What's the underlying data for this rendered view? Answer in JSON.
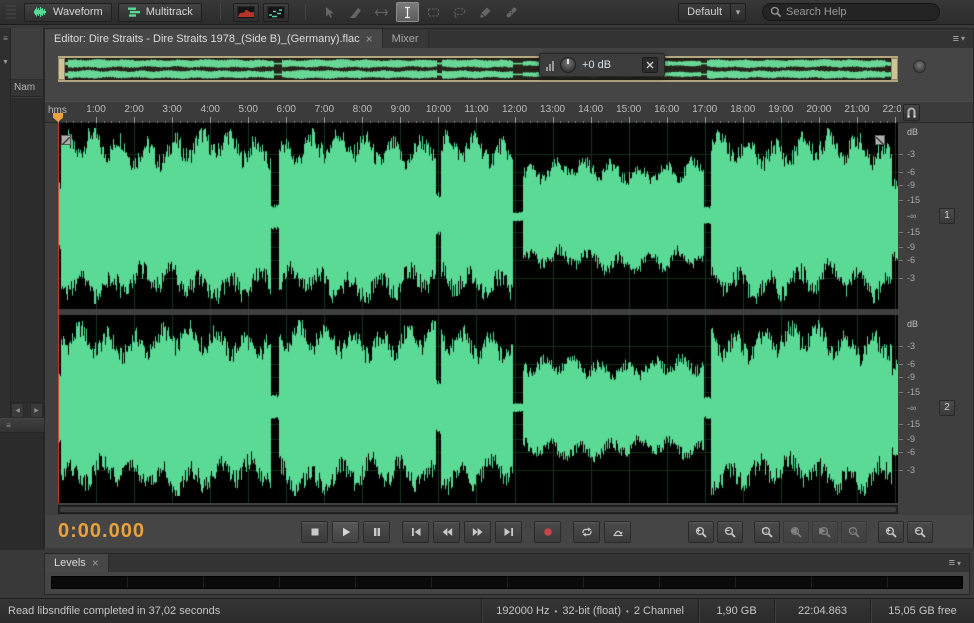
{
  "colors": {
    "wave_green": "#5ADA95",
    "grid_green": "#16361F",
    "center_green": "#2F7A48",
    "playhead_red": "#D83B3B",
    "handle_tan": "#CFC294",
    "accent_orange": "#E8A33D",
    "record_red": "#C84545"
  },
  "toolbar": {
    "waveform": "Waveform",
    "multitrack": "Multitrack",
    "workspace": "Default",
    "search_placeholder": "Search Help"
  },
  "tabs": {
    "editor": "Editor: Dire Straits - Dire Straits 1978_(Side B)_(Germany).flac",
    "mixer": "Mixer"
  },
  "hud": {
    "gain": "+0 dB"
  },
  "ruler": {
    "unit": "hms",
    "minute_ticks": [
      "1:00",
      "2:00",
      "3:00",
      "4:00",
      "5:00",
      "6:00",
      "7:00",
      "8:00",
      "9:00",
      "10:00",
      "11:00",
      "12:00",
      "13:00",
      "14:00",
      "15:00",
      "16:00",
      "17:00",
      "18:00",
      "19:00",
      "20:00",
      "21:00",
      "22:00"
    ]
  },
  "scale": {
    "header": "dB",
    "db_values": [
      -3,
      -6,
      -9,
      -15
    ],
    "db_labels": [
      "-3",
      "-6",
      "-9",
      "-15"
    ],
    "inf_label": "-∞"
  },
  "channels": {
    "one": "1",
    "two": "2"
  },
  "transport": {
    "time": "0:00.000"
  },
  "zoom": {
    "overlays": [
      "+",
      "−",
      "□",
      "◀",
      "▶",
      "□",
      "+",
      "−"
    ]
  },
  "levels": {
    "title": "Levels"
  },
  "files_panel": {
    "name_header": "Nam"
  },
  "status": {
    "message": "Read libsndfile completed in 37,02 seconds",
    "sample_rate": "192000 Hz",
    "bit_depth": "32-bit (float)",
    "channels": "2 Channel",
    "file_size": "1,90 GB",
    "duration": "22:04.863",
    "free_space": "15,05 GB free",
    "bullet": "•"
  },
  "icons": {
    "panel_menu": "≡",
    "chevron_down": "▾",
    "close": "×",
    "arrow_left": "◀",
    "arrow_right": "▶",
    "arrow_down": "▼"
  },
  "waveform": {
    "duration_min": 22.08,
    "segments": [
      {
        "t0": 0.0,
        "t1": 0.06,
        "a1": 0.4,
        "a2": 0.4
      },
      {
        "t0": 0.06,
        "t1": 5.58,
        "a1": 0.93,
        "a2": 0.92
      },
      {
        "t0": 5.58,
        "t1": 5.8,
        "a1": 0.16,
        "a2": 0.16
      },
      {
        "t0": 5.8,
        "t1": 9.93,
        "a1": 0.93,
        "a2": 0.93
      },
      {
        "t0": 9.93,
        "t1": 10.06,
        "a1": 0.3,
        "a2": 0.3
      },
      {
        "t0": 10.06,
        "t1": 11.95,
        "a1": 0.9,
        "a2": 0.9
      },
      {
        "t0": 11.95,
        "t1": 12.22,
        "a1": 0.06,
        "a2": 0.06
      },
      {
        "t0": 12.22,
        "t1": 16.98,
        "a1": 0.62,
        "a2": 0.56
      },
      {
        "t0": 16.98,
        "t1": 17.15,
        "a1": 0.13,
        "a2": 0.13
      },
      {
        "t0": 17.15,
        "t1": 21.9,
        "a1": 0.92,
        "a2": 0.92
      },
      {
        "t0": 21.9,
        "t1": 22.08,
        "a1": 0.55,
        "a2": 0.55
      }
    ]
  }
}
